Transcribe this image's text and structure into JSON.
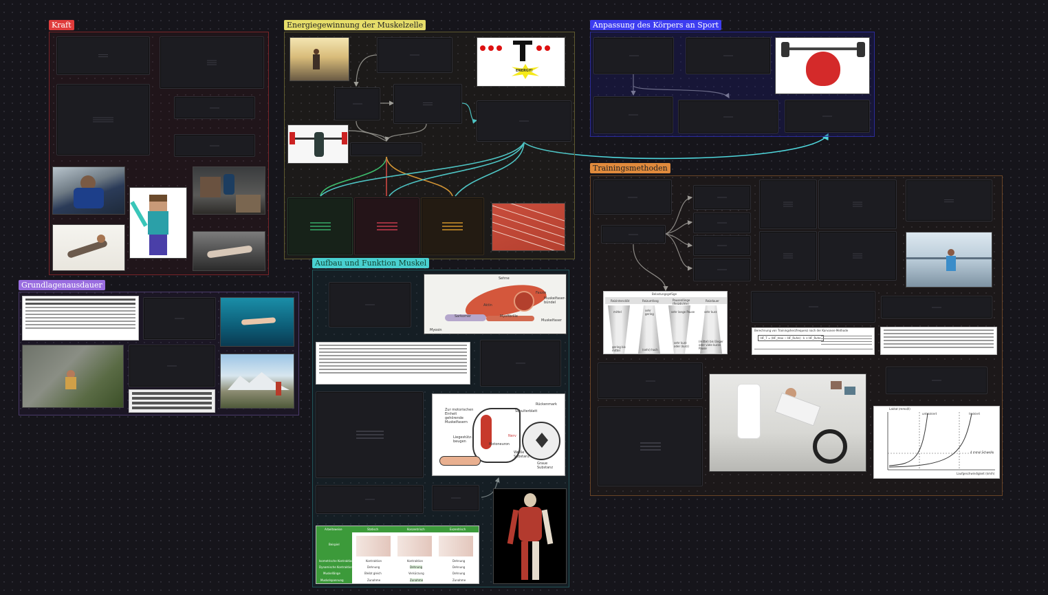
{
  "groups": {
    "kraft": {
      "title": "Kraft",
      "color": "#e03c3c"
    },
    "energie": {
      "title": "Energiegewinnung der Muskelzelle",
      "color": "#e6dd6a"
    },
    "anpassung": {
      "title": "Anpassung des Körpers an Sport",
      "color": "#3d3df0"
    },
    "trainingsmethoden": {
      "title": "Trainingsmethoden",
      "color": "#e08a3c"
    },
    "grundlagen": {
      "title": "Grundlagenausdauer",
      "color": "#9a6ee0"
    },
    "aufbau": {
      "title": "Aufbau und Funktion Muskel",
      "color": "#49d0d0"
    }
  },
  "atp_diagram": {
    "energy_label": "ENERGY!"
  },
  "muscle_diagram": {
    "labels": [
      "Sehne",
      "Muskel",
      "Faszie",
      "Muskelfaser-bündel",
      "Aktin",
      "Myosin",
      "Sarkomer",
      "Myofibrille",
      "Muskelfaser",
      "Aktin",
      "Myosin"
    ]
  },
  "nerve_diagram": {
    "labels": [
      "Zur motorischen Einheit gehörende Muskelfasern",
      "Schulterblatt",
      "Rückenmark",
      "Liegestütz-beugen",
      "Motoneuron",
      "Nerv",
      "Weiße Substanz",
      "Graue Substanz"
    ]
  },
  "muscle_table": {
    "headers": [
      "Arbeitsweise",
      "Statisch",
      "Konzentrisch",
      "Exzentrisch"
    ],
    "rows": [
      [
        "Beispiel",
        "",
        "",
        ""
      ],
      [
        "Isometrische Kontraktion",
        "Kontraktion",
        "Kontraktion",
        "Dehnung"
      ],
      [
        "Dynamische Kontraktion",
        "Dehnung",
        "Dehnung",
        "Dehnung"
      ],
      [
        "Muskellänge",
        "Bleibt gleich",
        "Verkürzung",
        "Dehnung"
      ],
      [
        "Muskelspannung",
        "Zunahme",
        "Zunahme",
        "Zunahme"
      ]
    ]
  },
  "methods_table": {
    "headers": [
      "Belastungsgefüge",
      "Reizintensität",
      "Reizumfang",
      "Pausenlänge (Reizdichte)",
      "Reizdauer"
    ],
    "cells": [
      "mittel",
      "sehr gering",
      "sehr lange Pause",
      "sehr kurz",
      "gering bis mittel",
      "(sehr) hoch",
      "sehr kurz oder (kurz)",
      "(mittel) bis länger oder viele kurze Pause"
    ]
  },
  "formula_card": {
    "title": "Berechnung von Trainingsherzfrequenz nach der Karvonen-Methode",
    "formula": "HF_T = (HF_max − HF_Ruhe) · k + HF_Ruhe"
  },
  "lactate_chart": {
    "labels": [
      "Laktat (mmol/l)",
      "untrainiert",
      "trainiert",
      "Laufgeschwindigkeit (km/h)",
      "4 mmol Schwelle"
    ]
  },
  "steve_label": "Minecraft Steve",
  "colors": {
    "accent_green": "#3ccf7a",
    "accent_red": "#e14a4a",
    "accent_orange": "#e5a03a",
    "accent_cyan": "#4fd7dd"
  }
}
